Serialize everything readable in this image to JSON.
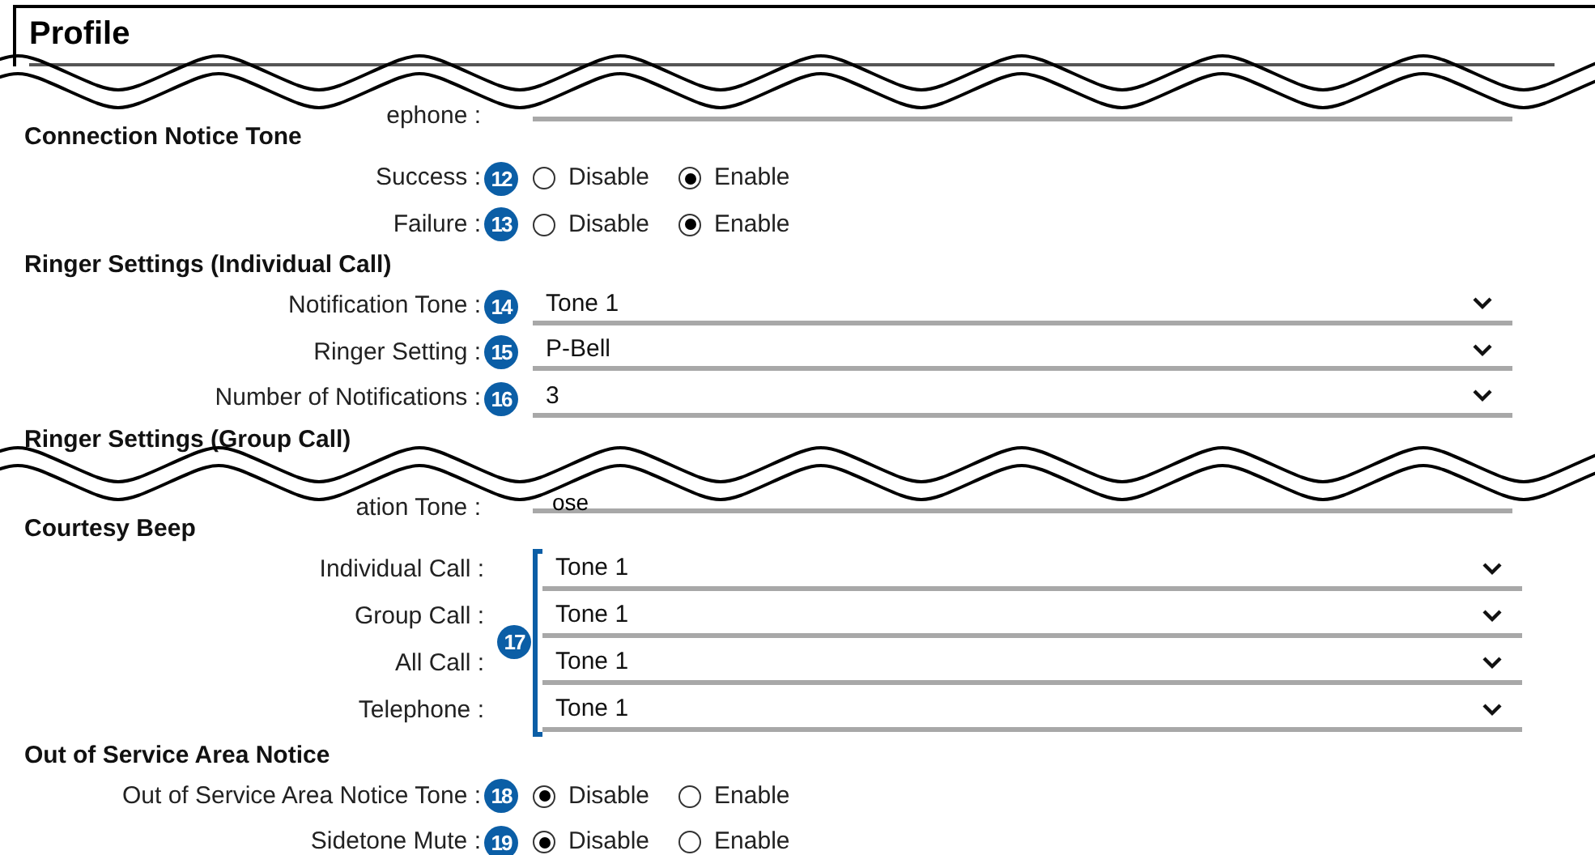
{
  "title": "Profile",
  "items": [
    {
      "kind": "break"
    },
    {
      "kind": "partial",
      "label": "ephone :",
      "value": ""
    },
    {
      "kind": "heading",
      "text": "Connection Notice Tone"
    },
    {
      "kind": "radio",
      "label": "Success :",
      "badge": "12",
      "options": [
        {
          "label": "Disable",
          "selected": false
        },
        {
          "label": "Enable",
          "selected": true
        }
      ]
    },
    {
      "kind": "radio",
      "label": "Failure :",
      "badge": "13",
      "options": [
        {
          "label": "Disable",
          "selected": false
        },
        {
          "label": "Enable",
          "selected": true
        }
      ]
    },
    {
      "kind": "heading",
      "text": "Ringer Settings (Individual Call)"
    },
    {
      "kind": "select",
      "label": "Notification Tone :",
      "badge": "14",
      "value": "Tone 1"
    },
    {
      "kind": "select",
      "label": "Ringer Setting :",
      "badge": "15",
      "value": "P-Bell"
    },
    {
      "kind": "select",
      "label": "Number of Notifications :",
      "badge": "16",
      "value": "3"
    },
    {
      "kind": "heading",
      "text": "Ringer Settings (Group Call)"
    },
    {
      "kind": "break"
    },
    {
      "kind": "partial",
      "label": "ation Tone :",
      "value": "ose"
    },
    {
      "kind": "heading",
      "text": "Courtesy Beep"
    },
    {
      "kind": "group",
      "badge": "17",
      "rows": [
        {
          "label": "Individual Call :",
          "value": "Tone 1"
        },
        {
          "label": "Group Call :",
          "value": "Tone 1"
        },
        {
          "label": "All Call :",
          "value": "Tone 1"
        },
        {
          "label": "Telephone :",
          "value": "Tone 1"
        }
      ]
    },
    {
      "kind": "heading",
      "text": "Out of Service Area Notice"
    },
    {
      "kind": "radio",
      "label": "Out of Service Area Notice Tone :",
      "badge": "18",
      "options": [
        {
          "label": "Disable",
          "selected": true
        },
        {
          "label": "Enable",
          "selected": false
        }
      ]
    },
    {
      "kind": "radio",
      "label": "Sidetone Mute :",
      "badge": "19",
      "options": [
        {
          "label": "Disable",
          "selected": true
        },
        {
          "label": "Enable",
          "selected": false
        }
      ]
    }
  ]
}
